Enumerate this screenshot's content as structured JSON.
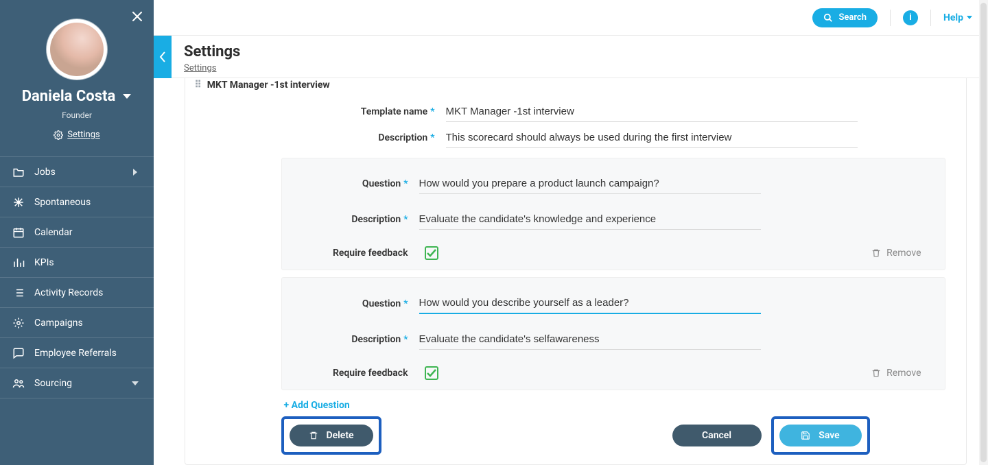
{
  "user": {
    "name": "Daniela Costa",
    "role": "Founder",
    "settings_link": "Settings"
  },
  "nav": {
    "items": [
      {
        "label": "Jobs",
        "icon": "folder",
        "has_submenu": true
      },
      {
        "label": "Spontaneous",
        "icon": "asterisk",
        "has_submenu": false
      },
      {
        "label": "Calendar",
        "icon": "calendar",
        "has_submenu": false
      },
      {
        "label": "KPIs",
        "icon": "bars",
        "has_submenu": false
      },
      {
        "label": "Activity Records",
        "icon": "list",
        "has_submenu": false
      },
      {
        "label": "Campaigns",
        "icon": "campaign",
        "has_submenu": false
      },
      {
        "label": "Employee Referrals",
        "icon": "chat",
        "has_submenu": false
      },
      {
        "label": "Sourcing",
        "icon": "people",
        "has_submenu": true,
        "submenu_style": "dropdown"
      }
    ]
  },
  "topbar": {
    "search_label": "Search",
    "help_label": "Help"
  },
  "header": {
    "title": "Settings",
    "breadcrumb": "Settings"
  },
  "template": {
    "header": "MKT Manager -1st interview",
    "name_label": "Template name",
    "name_value": "MKT Manager -1st interview",
    "desc_label": "Description",
    "desc_value": "This scorecard should always be used during the first interview"
  },
  "questions": [
    {
      "question_label": "Question",
      "question_value": "How would you prepare a product launch campaign?",
      "desc_label": "Description",
      "desc_value": "Evaluate the candidate's knowledge and experience",
      "feedback_label": "Require feedback",
      "feedback_checked": true,
      "remove_label": "Remove",
      "focused": false
    },
    {
      "question_label": "Question",
      "question_value": "How would you describe yourself as a leader?",
      "desc_label": "Description",
      "desc_value": "Evaluate the candidate's selfawareness",
      "feedback_label": "Require feedback",
      "feedback_checked": true,
      "remove_label": "Remove",
      "focused": true
    }
  ],
  "actions": {
    "add_question": "+ Add Question",
    "delete": "Delete",
    "cancel": "Cancel",
    "save": "Save"
  },
  "colors": {
    "sidebar": "#3e5f77",
    "accent": "#19ade4",
    "highlight": "#1d5fbf",
    "success": "#3fb552",
    "dark_btn": "#405a6c"
  }
}
